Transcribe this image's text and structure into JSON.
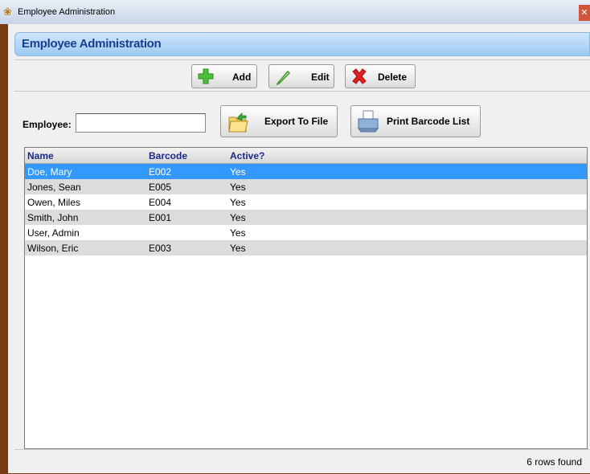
{
  "window": {
    "title": "Employee Administration",
    "close_glyph": "✕"
  },
  "header": {
    "title": "Employee Administration"
  },
  "toolbar": {
    "add_label": "Add",
    "edit_label": "Edit",
    "delete_label": "Delete"
  },
  "filter": {
    "employee_label": "Employee:",
    "employee_value": ""
  },
  "actions": {
    "export_label": "Export To File",
    "print_label": "Print Barcode List"
  },
  "table": {
    "columns": [
      "Name",
      "Barcode",
      "Active?"
    ],
    "rows": [
      {
        "name": "Doe, Mary",
        "barcode": "E002",
        "active": "Yes"
      },
      {
        "name": "Jones, Sean",
        "barcode": "E005",
        "active": "Yes"
      },
      {
        "name": "Owen, Miles",
        "barcode": "E004",
        "active": "Yes"
      },
      {
        "name": "Smith, John",
        "barcode": "E001",
        "active": "Yes"
      },
      {
        "name": "User, Admin",
        "barcode": "",
        "active": "Yes"
      },
      {
        "name": "Wilson, Eric",
        "barcode": "E003",
        "active": "Yes"
      }
    ],
    "selected_row": 0
  },
  "status": {
    "text": "6 rows found"
  },
  "icons": {
    "add": "plus-icon",
    "edit": "pencil-icon",
    "delete": "delete-x-icon",
    "export": "folder-export-icon",
    "print": "printer-icon"
  },
  "colors": {
    "selection": "#3399ff",
    "header_text": "#1a3d8f",
    "column_header_text": "#1a2a8a"
  }
}
